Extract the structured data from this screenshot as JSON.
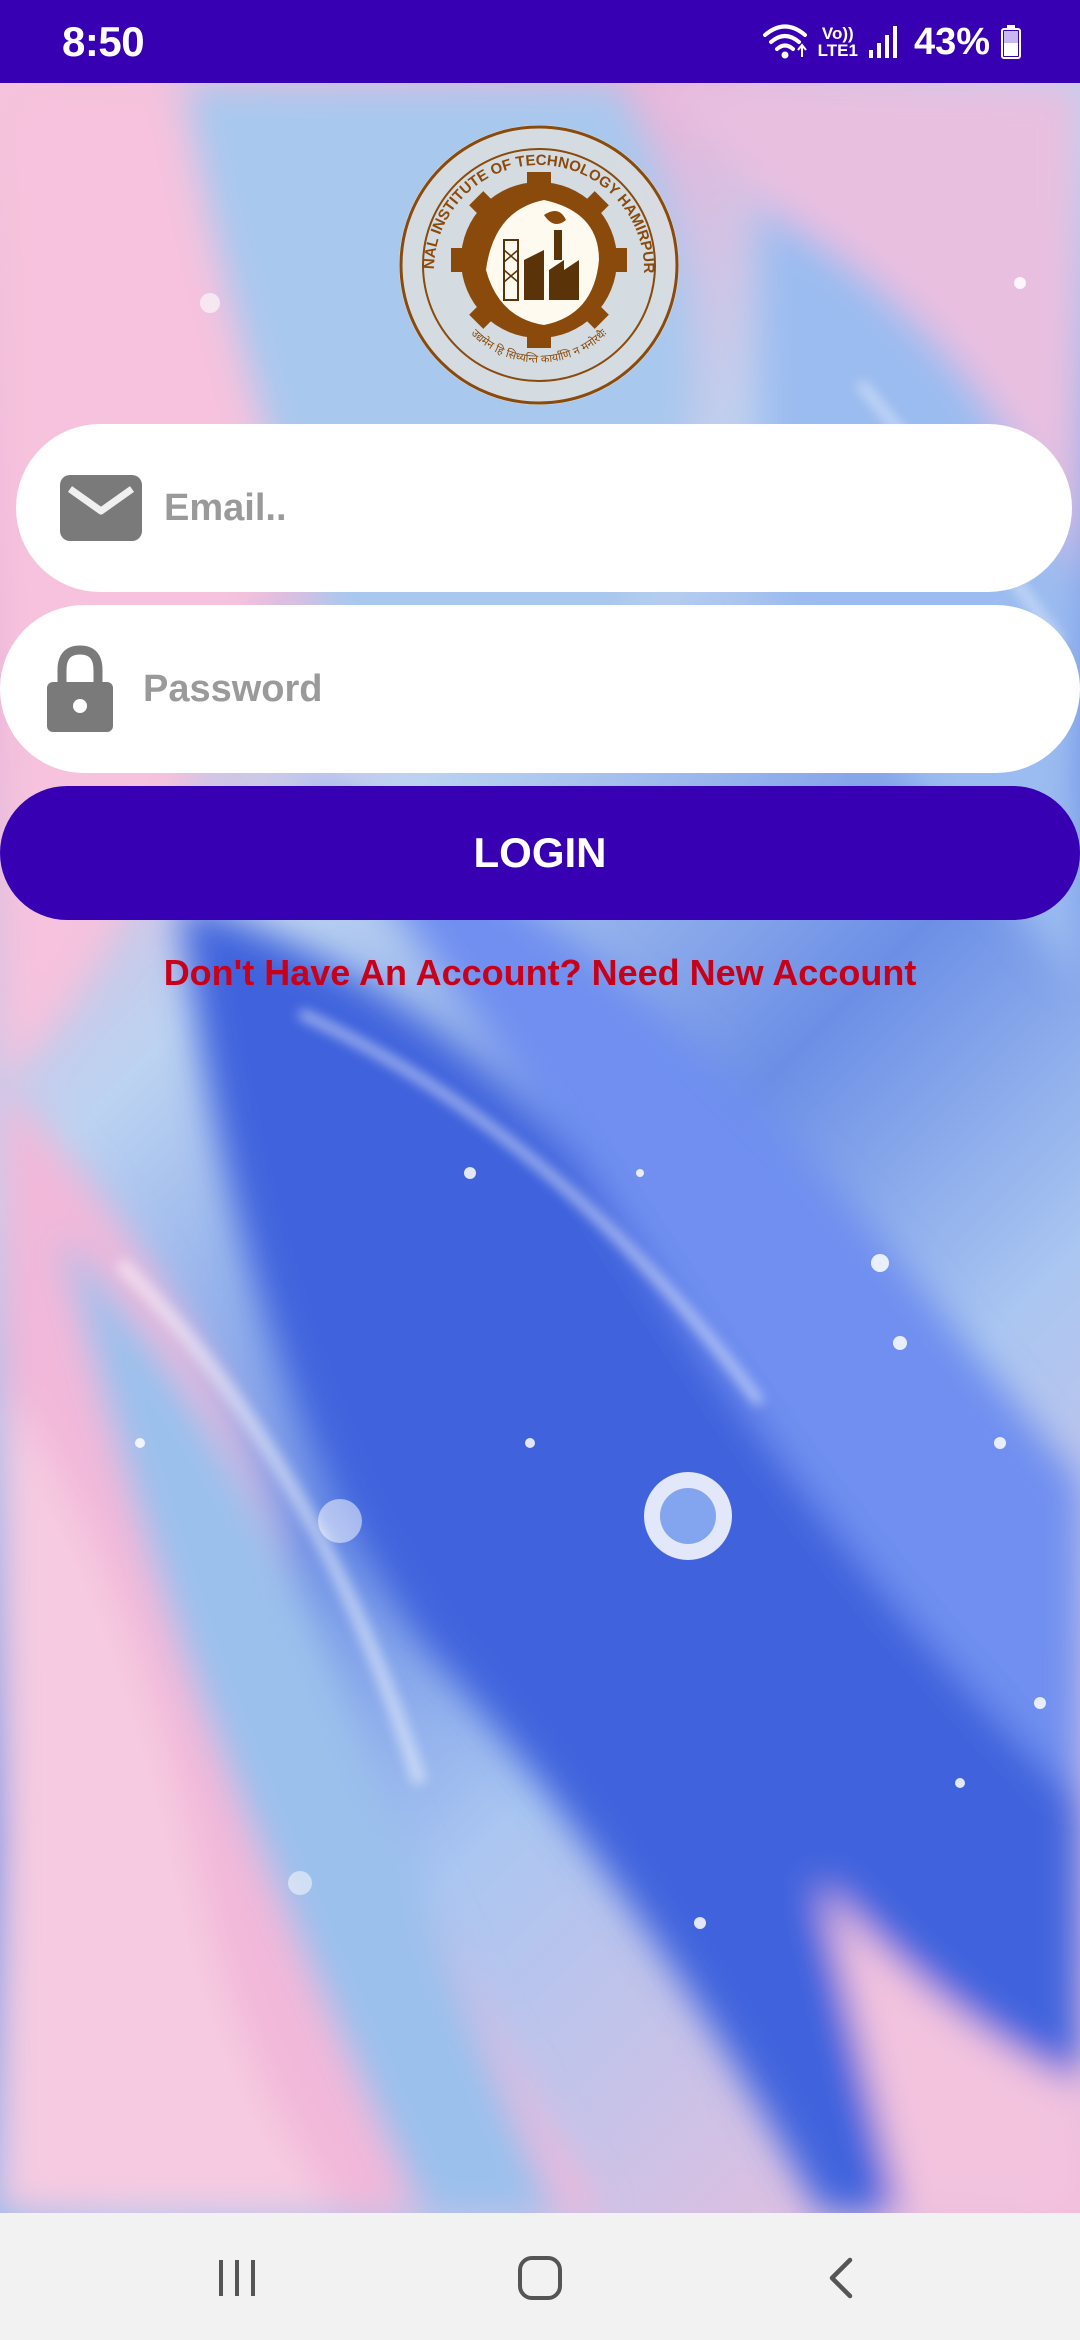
{
  "status_bar": {
    "time": "8:50",
    "network_line1": "Vo))",
    "network_line2": "LTE1",
    "battery": "43%",
    "icons": [
      "wifi-icon",
      "signal-icon",
      "battery-icon"
    ]
  },
  "logo": {
    "ring_text": "NATIONAL INSTITUTE OF TECHNOLOGY HAMIRPUR (H.P.)",
    "motto": "उद्यमेन हि सिध्यन्ति कार्याणि न मनोरथैः"
  },
  "form": {
    "email_placeholder": "Email..",
    "email_value": "",
    "email_icon": "envelope-icon",
    "password_placeholder": "Password",
    "password_value": "",
    "password_icon": "lock-icon",
    "login_label": "LOGIN",
    "signup_link": "Don't Have An Account? Need New Account"
  },
  "nav": {
    "icons": [
      "recent-apps-icon",
      "home-icon",
      "back-icon"
    ]
  },
  "colors": {
    "primary": "#3700b3",
    "link": "#c8001a",
    "logo_brown": "#8a4a0b"
  }
}
